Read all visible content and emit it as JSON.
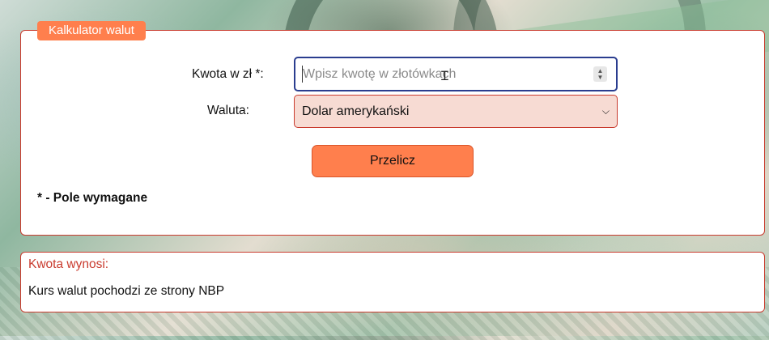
{
  "calculator": {
    "legend": "Kalkulator walut",
    "amount_label": "Kwota w zł *:",
    "amount_placeholder": "Wpisz kwotę w złotówkach",
    "amount_value": "",
    "currency_label": "Waluta:",
    "currency_selected": "Dolar amerykański",
    "submit_label": "Przelicz",
    "required_note": "* - Pole wymagane"
  },
  "result": {
    "label": "Kwota wynosi:",
    "source_note": "Kurs walut pochodzi ze strony NBP"
  },
  "icons": {
    "spinner": "number-spinner-icon",
    "select_arrow": "chevron-down-icon",
    "cursor": "text-cursor-icon"
  },
  "colors": {
    "accent": "#ff7f4d",
    "border": "#c93b2e",
    "select_bg": "#f7dbd3",
    "focus": "#2a3d8f"
  }
}
